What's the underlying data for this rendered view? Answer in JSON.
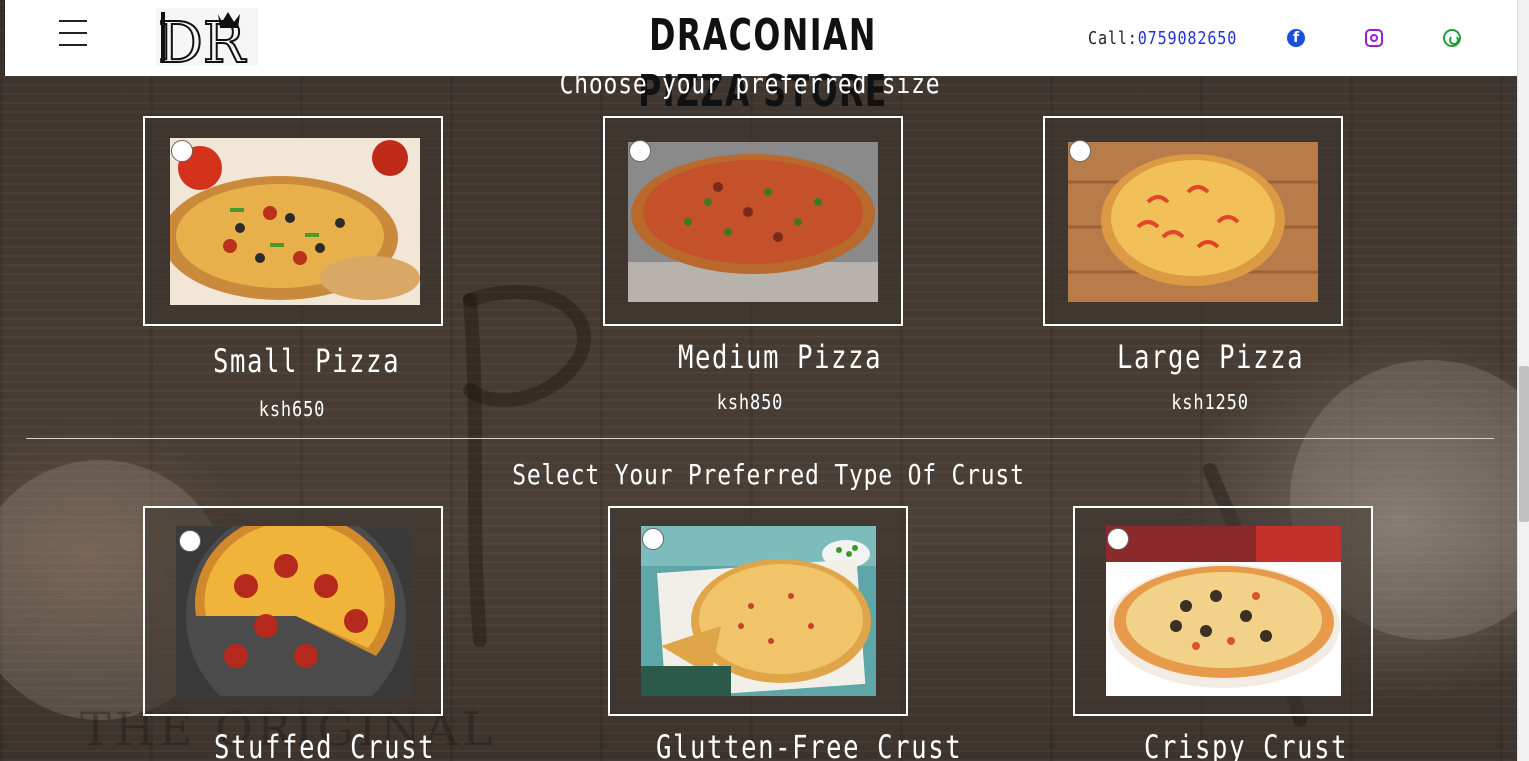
{
  "header": {
    "brand": "DRACONIAN PIZZA STORE",
    "logo_text": "DR",
    "call_label": "Call:",
    "phone": "0759082650",
    "icons": [
      "menu-icon",
      "facebook-icon",
      "instagram-icon",
      "whatsapp-icon"
    ]
  },
  "size_section": {
    "title": "Choose your preferred size",
    "options": [
      {
        "name": "Small Pizza",
        "price": "ksh650"
      },
      {
        "name": "Medium Pizza",
        "price": "ksh850"
      },
      {
        "name": "Large Pizza",
        "price": "ksh1250"
      }
    ]
  },
  "crust_section": {
    "title": "Select Your Preferred Type Of Crust",
    "options": [
      {
        "name": "Stuffed Crust"
      },
      {
        "name": "Glutten-Free Crust"
      },
      {
        "name": "Crispy Crust"
      }
    ]
  },
  "colors": {
    "header_bg": "#ffffff",
    "phone_link": "#2233dd",
    "facebook": "#1a4fe0",
    "instagram": "#9a1fc7",
    "whatsapp": "#1f9d3a",
    "text_on_bg": "#ffffff"
  }
}
